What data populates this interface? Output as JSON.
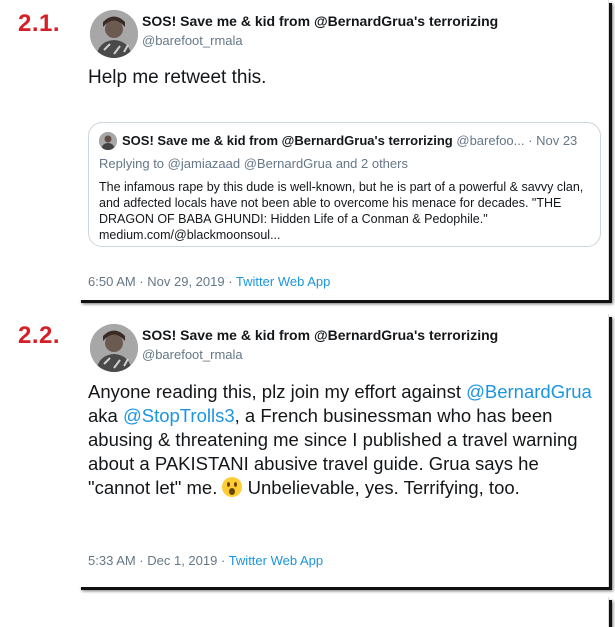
{
  "sections": {
    "first_label": "2.1.",
    "second_label": "2.2."
  },
  "tweet1": {
    "display_name": "SOS! Save me & kid from @BernardGrua's terrorizing",
    "handle": "@barefoot_rmala",
    "text": "Help me retweet this.",
    "quote": {
      "display_name": "SOS! Save me & kid from @BernardGrua's terrorizing",
      "handle_trunc": "@barefoo...",
      "separator": "·",
      "date": "Nov 23",
      "replying_prefix": "Replying to",
      "replying_to": "@jamiazaad @BernardGrua and 2 others",
      "text": "The infamous rape by this dude is well-known, but he is part of a powerful & savvy clan, and adfected locals have not been able to overcome his menace for decades.  \"THE DRAGON OF BABA GHUNDI: Hidden Life of a Conman & Pedophile.\" medium.com/@blackmoonsoul..."
    },
    "timestamp": "6:50 AM · Nov 29, 2019 ·",
    "source": "Twitter Web App"
  },
  "tweet2": {
    "display_name": "SOS! Save me & kid from @BernardGrua's terrorizing",
    "handle": "@barefoot_rmala",
    "text_part1": "Anyone reading this, plz join my effort against",
    "mention1": "@BernardGrua",
    "text_part2": "aka",
    "mention2": "@StopTrolls3",
    "text_part3": ", a French businessman who has been abusing & threatening me since I published a travel warning about a PAKISTANI abusive travel guide. Grua says he \"cannot let\" me.",
    "emoji_name": "astonished-face-icon",
    "text_part4": "Unbelievable, yes. Terrifying, too.",
    "timestamp": "5:33 AM · Dec 1, 2019 ·",
    "source": "Twitter Web App"
  },
  "colors": {
    "section_label": "#d51f26",
    "link": "#1b95e0",
    "muted": "#657786"
  }
}
